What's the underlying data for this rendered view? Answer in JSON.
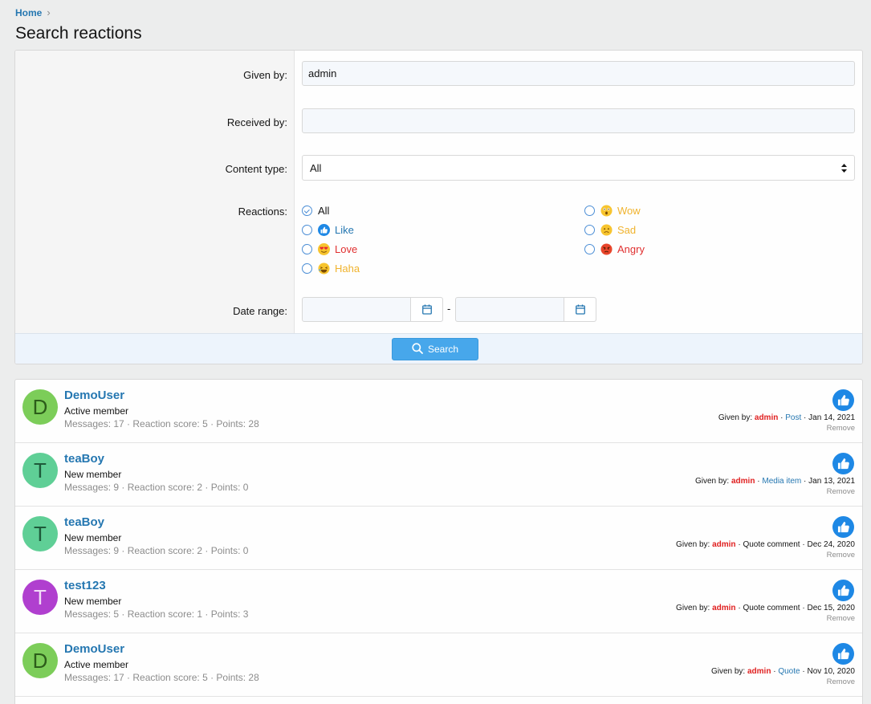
{
  "breadcrumb": {
    "home": "Home",
    "chevron": "›"
  },
  "page_title": "Search reactions",
  "form": {
    "given_by_label": "Given by:",
    "given_by_value": "admin",
    "received_by_label": "Received by:",
    "received_by_value": "",
    "content_type_label": "Content type:",
    "content_type_value": "All",
    "reactions_label": "Reactions:",
    "reactions": [
      {
        "label": "All",
        "color": "#141414",
        "checked": true
      },
      {
        "label": "Like",
        "color": "#2577b1",
        "icon": "like-icon"
      },
      {
        "label": "Love",
        "color": "#e03030",
        "icon": "love-icon"
      },
      {
        "label": "Haha",
        "color": "#f0b32e",
        "icon": "haha-icon"
      },
      {
        "label": "Wow",
        "color": "#f0b32e",
        "icon": "wow-icon"
      },
      {
        "label": "Sad",
        "color": "#f0b32e",
        "icon": "sad-icon"
      },
      {
        "label": "Angry",
        "color": "#e03030",
        "icon": "angry-icon"
      }
    ],
    "date_range_label": "Date range:",
    "date_separator": "-",
    "search_button": "Search"
  },
  "results": [
    {
      "initial": "D",
      "avatar_color": "#7ccd59",
      "avatar_text_color": "#2c5d1a",
      "username": "DemoUser",
      "title": "Active member",
      "stats": "Messages: 17 · Reaction score: 5 · Points: 28",
      "given_prefix": "Given by:",
      "given_by": "admin",
      "sep1": "·",
      "content_type": "Post",
      "content_is_link": true,
      "sep2": "·",
      "date": "Jan 14, 2021",
      "remove": "Remove"
    },
    {
      "initial": "T",
      "avatar_color": "#5fcf96",
      "avatar_text_color": "#1e5a3a",
      "username": "teaBoy",
      "title": "New member",
      "stats": "Messages: 9 · Reaction score: 2 · Points: 0",
      "given_prefix": "Given by:",
      "given_by": "admin",
      "sep1": "·",
      "content_type": "Media item",
      "content_is_link": true,
      "sep2": "·",
      "date": "Jan 13, 2021",
      "remove": "Remove"
    },
    {
      "initial": "T",
      "avatar_color": "#5fcf96",
      "avatar_text_color": "#1e5a3a",
      "username": "teaBoy",
      "title": "New member",
      "stats": "Messages: 9 · Reaction score: 2 · Points: 0",
      "given_prefix": "Given by:",
      "given_by": "admin",
      "sep1": "·",
      "content_type": "Quote comment",
      "content_is_link": false,
      "sep2": "·",
      "date": "Dec 24, 2020",
      "remove": "Remove"
    },
    {
      "initial": "T",
      "avatar_color": "#b03fcf",
      "avatar_text_color": "#f1dcf7",
      "username": "test123",
      "title": "New member",
      "stats": "Messages: 5 · Reaction score: 1 · Points: 3",
      "given_prefix": "Given by:",
      "given_by": "admin",
      "sep1": "·",
      "content_type": "Quote comment",
      "content_is_link": false,
      "sep2": "·",
      "date": "Dec 15, 2020",
      "remove": "Remove"
    },
    {
      "initial": "D",
      "avatar_color": "#7ccd59",
      "avatar_text_color": "#2c5d1a",
      "username": "DemoUser",
      "title": "Active member",
      "stats": "Messages: 17 · Reaction score: 5 · Points: 28",
      "given_prefix": "Given by:",
      "given_by": "admin",
      "sep1": "·",
      "content_type": "Quote",
      "content_is_link": true,
      "sep2": "·",
      "date": "Nov 10, 2020",
      "remove": "Remove"
    }
  ]
}
